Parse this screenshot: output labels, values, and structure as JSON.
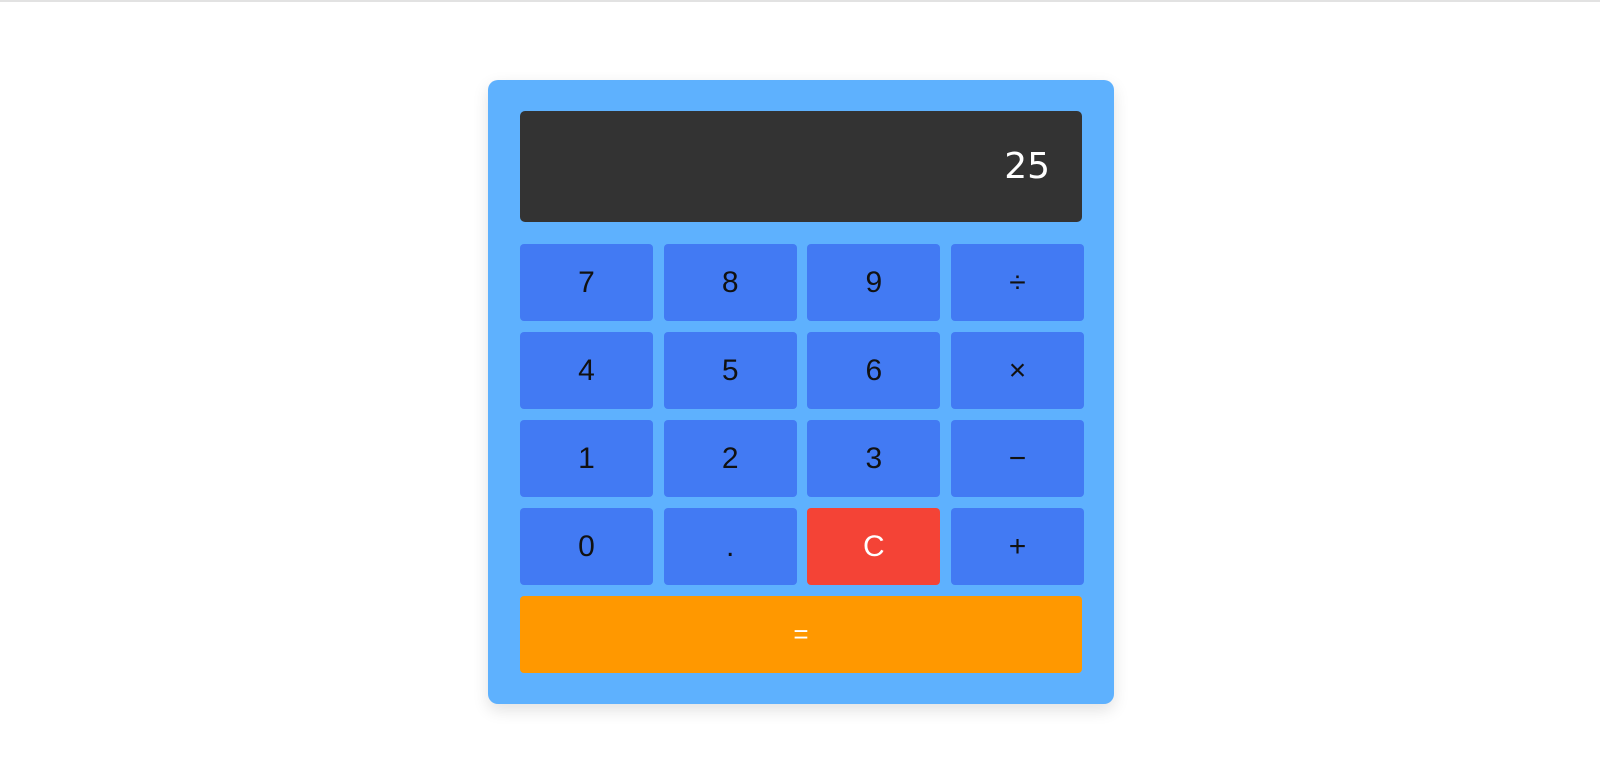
{
  "display": {
    "value": "25"
  },
  "keys": {
    "seven": "7",
    "eight": "8",
    "nine": "9",
    "divide": "÷",
    "four": "4",
    "five": "5",
    "six": "6",
    "multiply": "×",
    "one": "1",
    "two": "2",
    "three": "3",
    "subtract": "−",
    "zero": "0",
    "decimal": ".",
    "clear": "C",
    "add": "+",
    "equals": "="
  },
  "colors": {
    "calculator_bg": "#5eb1fe",
    "display_bg": "#333333",
    "key_bg": "#427af3",
    "clear_bg": "#f44336",
    "equals_bg": "#ff9800"
  }
}
